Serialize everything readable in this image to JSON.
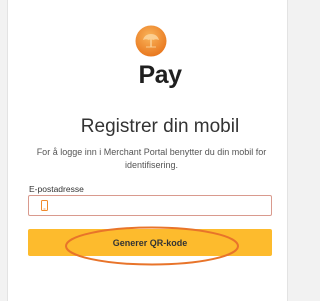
{
  "brand": {
    "name": "Pay",
    "logo_icon": "tree-coin-logo-icon"
  },
  "page": {
    "title": "Registrer din mobil",
    "subtitle": "For å logge inn i Merchant Portal benytter du din mobil for identifisering."
  },
  "form": {
    "email_label": "E-postadresse",
    "email_value": "",
    "email_icon": "phone-icon"
  },
  "actions": {
    "generate_label": "Generer QR-kode"
  },
  "colors": {
    "accent": "#fdbb2d",
    "logo_orange": "#f08a2c",
    "highlight_ring": "#e8742a",
    "input_border": "#d99a8e"
  }
}
